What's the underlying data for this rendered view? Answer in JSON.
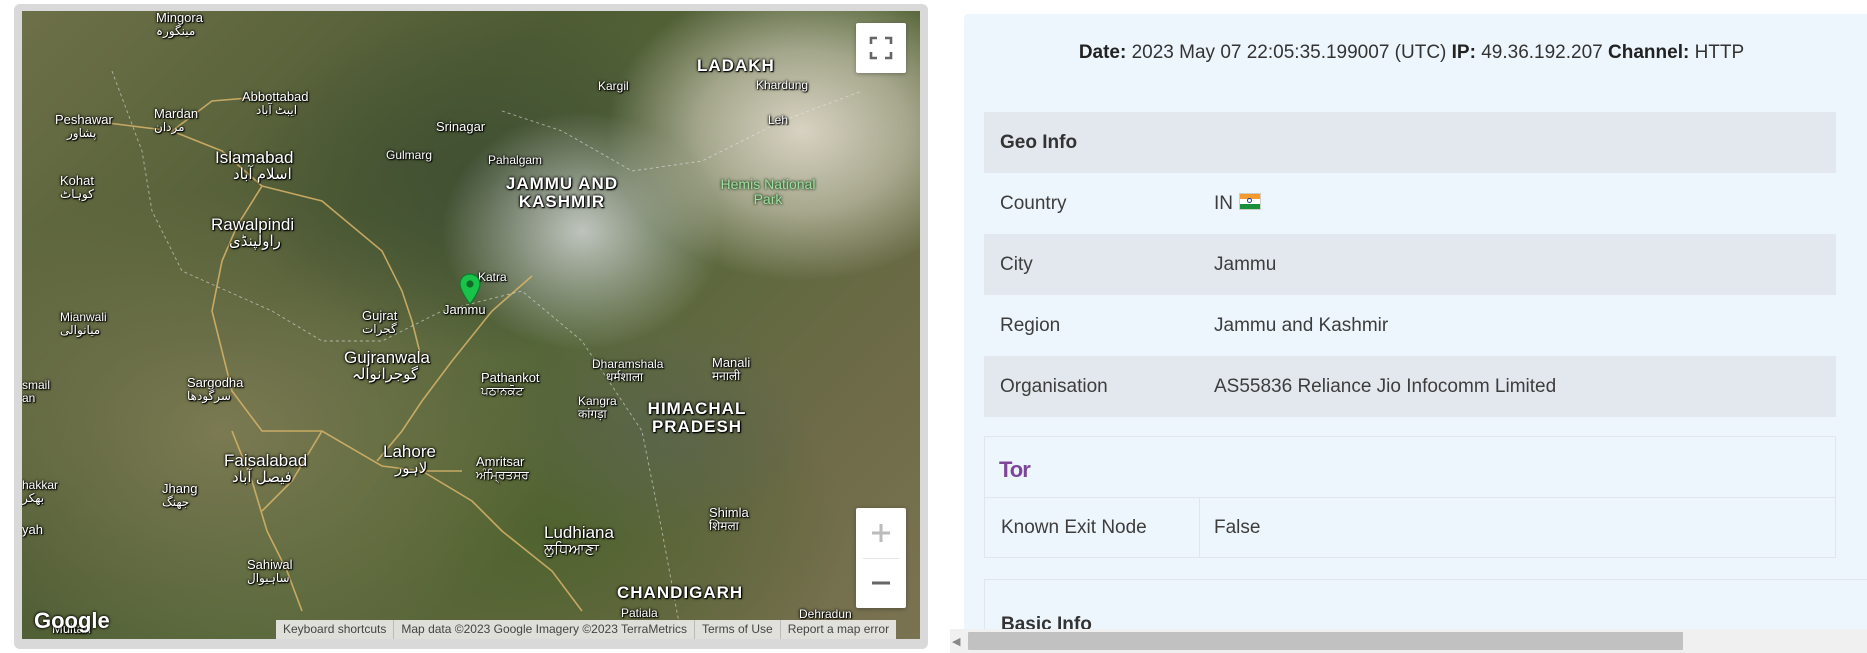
{
  "map": {
    "places": [
      {
        "id": "mingora",
        "name": "Mingora",
        "sub": "مینگورہ"
      },
      {
        "id": "abbottabad",
        "name": "Abbottabad",
        "sub": "ایبٹ آباد"
      },
      {
        "id": "peshawar",
        "name": "Peshawar",
        "sub": "پشاور"
      },
      {
        "id": "mardan",
        "name": "Mardan",
        "sub": "مردان"
      },
      {
        "id": "islamabad",
        "name": "Islamabad",
        "sub": "اسلام آباد"
      },
      {
        "id": "kohat",
        "name": "Kohat",
        "sub": "کوہاٹ"
      },
      {
        "id": "rawalpindi",
        "name": "Rawalpindi",
        "sub": "راولپنڈی"
      },
      {
        "id": "srinagar",
        "name": "Srinagar",
        "sub": ""
      },
      {
        "id": "gulmarg",
        "name": "Gulmarg",
        "sub": ""
      },
      {
        "id": "pahalgam",
        "name": "Pahalgam",
        "sub": ""
      },
      {
        "id": "kargil",
        "name": "Kargil",
        "sub": ""
      },
      {
        "id": "khardung",
        "name": "Khardung",
        "sub": ""
      },
      {
        "id": "leh",
        "name": "Leh",
        "sub": ""
      },
      {
        "id": "katra",
        "name": "Katra",
        "sub": ""
      },
      {
        "id": "jammu",
        "name": "Jammu",
        "sub": ""
      },
      {
        "id": "mianwali",
        "name": "Mianwali",
        "sub": "میانوالی"
      },
      {
        "id": "gujrat",
        "name": "Gujrat",
        "sub": "گجرات"
      },
      {
        "id": "gujranwala",
        "name": "Gujranwala",
        "sub": "گوجرانوالہ"
      },
      {
        "id": "sargodha",
        "name": "Sargodha",
        "sub": "سرگودھا"
      },
      {
        "id": "pathankot",
        "name": "Pathankot",
        "sub": "ਪਠਾਨਕੋਟ"
      },
      {
        "id": "dharamshala",
        "name": "Dharamshala",
        "sub": "धर्मशाला"
      },
      {
        "id": "manali",
        "name": "Manali",
        "sub": "मनाली"
      },
      {
        "id": "kangra",
        "name": "Kangra",
        "sub": "कांगड़ा"
      },
      {
        "id": "faisalabad",
        "name": "Faisalabad",
        "sub": "فیصل آباد"
      },
      {
        "id": "lahore",
        "name": "Lahore",
        "sub": "لاہور"
      },
      {
        "id": "amritsar",
        "name": "Amritsar",
        "sub": "ਅੰਮ੍ਰਿਤਸਰ"
      },
      {
        "id": "jhang",
        "name": "Jhang",
        "sub": "جھنگ"
      },
      {
        "id": "ludhiana",
        "name": "Ludhiana",
        "sub": "ਲੁਧਿਆਣਾ"
      },
      {
        "id": "shimla",
        "name": "Shimla",
        "sub": "शिमला"
      },
      {
        "id": "sahiwal",
        "name": "Sahiwal",
        "sub": "ساہیوال"
      },
      {
        "id": "patiala",
        "name": "Patiala",
        "sub": ""
      },
      {
        "id": "dehradun",
        "name": "Dehradun",
        "sub": ""
      },
      {
        "id": "multan",
        "name": "Multan",
        "sub": ""
      },
      {
        "id": "ismail",
        "name": "smail",
        "sub": "an"
      },
      {
        "id": "bhakkar",
        "name": "hakkar",
        "sub": "بھکر"
      },
      {
        "id": "yah",
        "name": "yah",
        "sub": ""
      }
    ],
    "regions": [
      {
        "id": "ladakh",
        "name": "LADAKH"
      },
      {
        "id": "jk",
        "name": "JAMMU AND KASHMIR"
      },
      {
        "id": "hp",
        "name": "HIMACHAL PRADESH"
      },
      {
        "id": "chandigarh",
        "name": "CHANDIGARH"
      }
    ],
    "park": "Hemis National Park",
    "google_logo": "Google",
    "attribution": [
      "Keyboard shortcuts",
      "Map data ©2023 Google Imagery ©2023 TerraMetrics",
      "Terms of Use",
      "Report a map error"
    ],
    "icons": {
      "fullscreen": "fullscreen-icon",
      "zoom_in": "plus-icon",
      "zoom_out": "minus-icon",
      "marker": "map-pin-icon"
    },
    "marker_color": "#19c34a"
  },
  "meta": {
    "date_label": "Date:",
    "date_value": "2023 May 07 22:05:35.199007 (UTC)",
    "ip_label": "IP:",
    "ip_value": "49.36.192.207",
    "channel_label": "Channel:",
    "channel_value": "HTTP"
  },
  "geo": {
    "title": "Geo Info",
    "rows": [
      {
        "key": "Country",
        "value": "IN"
      },
      {
        "key": "City",
        "value": "Jammu"
      },
      {
        "key": "Region",
        "value": "Jammu and Kashmir"
      },
      {
        "key": "Organisation",
        "value": "AS55836 Reliance Jio Infocomm Limited"
      }
    ]
  },
  "tor": {
    "logo": "Tor",
    "rows": [
      {
        "key": "Known Exit Node",
        "value": "False"
      }
    ]
  },
  "basic": {
    "title": "Basic Info"
  },
  "colors": {
    "panel_bg": "#eef6fd",
    "row_shade": "#e3e8ee",
    "tor_purple": "#7d4698"
  }
}
